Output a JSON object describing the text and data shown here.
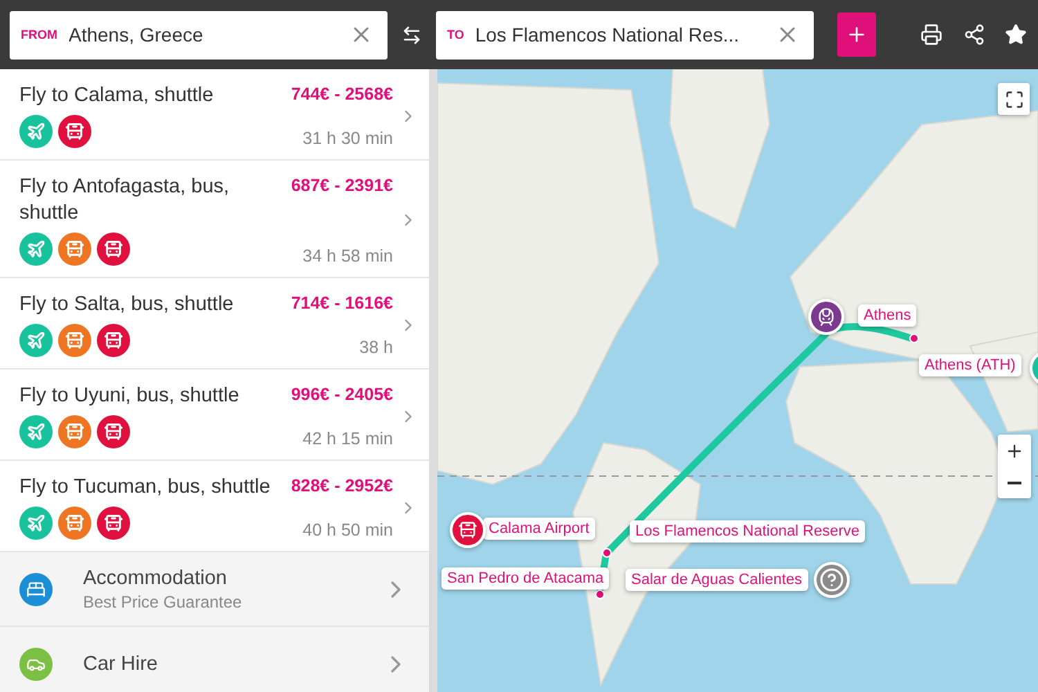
{
  "search": {
    "from": {
      "label": "FROM",
      "value": "Athens, Greece"
    },
    "to": {
      "label": "TO",
      "value": "Los Flamencos National Res..."
    }
  },
  "routes": [
    {
      "title": "Fly to Calama, shuttle",
      "price": "744€ - 2568€",
      "duration": "31 h 30 min",
      "modes": [
        {
          "kind": "plane"
        },
        {
          "kind": "shuttle"
        }
      ]
    },
    {
      "title": "Fly to Antofagasta, bus, shuttle",
      "price": "687€ - 2391€",
      "duration": "34 h 58 min",
      "modes": [
        {
          "kind": "plane"
        },
        {
          "kind": "bus"
        },
        {
          "kind": "shuttle"
        }
      ]
    },
    {
      "title": "Fly to Salta, bus, shuttle",
      "price": "714€ - 1616€",
      "duration": "38 h",
      "modes": [
        {
          "kind": "plane"
        },
        {
          "kind": "bus"
        },
        {
          "kind": "shuttle"
        }
      ]
    },
    {
      "title": "Fly to Uyuni, bus, shuttle",
      "price": "996€ - 2405€",
      "duration": "42 h 15 min",
      "modes": [
        {
          "kind": "plane"
        },
        {
          "kind": "bus"
        },
        {
          "kind": "shuttle"
        }
      ]
    },
    {
      "title": "Fly to Tucuman, bus, shuttle",
      "price": "828€ - 2952€",
      "duration": "40 h 50 min",
      "modes": [
        {
          "kind": "plane"
        },
        {
          "kind": "bus"
        },
        {
          "kind": "shuttle"
        }
      ]
    }
  ],
  "services": [
    {
      "kind": "accommodation",
      "title": "Accommodation",
      "subtitle": "Best Price Guarantee"
    },
    {
      "kind": "car",
      "title": "Car Hire"
    }
  ],
  "map": {
    "labels": [
      {
        "text": "Athens"
      },
      {
        "text": "Athens (ATH)"
      },
      {
        "text": "Calama Airport"
      },
      {
        "text": "Los Flamencos National Reserve"
      },
      {
        "text": "San Pedro de Atacama"
      },
      {
        "text": "Salar de Aguas Calientes"
      }
    ]
  }
}
